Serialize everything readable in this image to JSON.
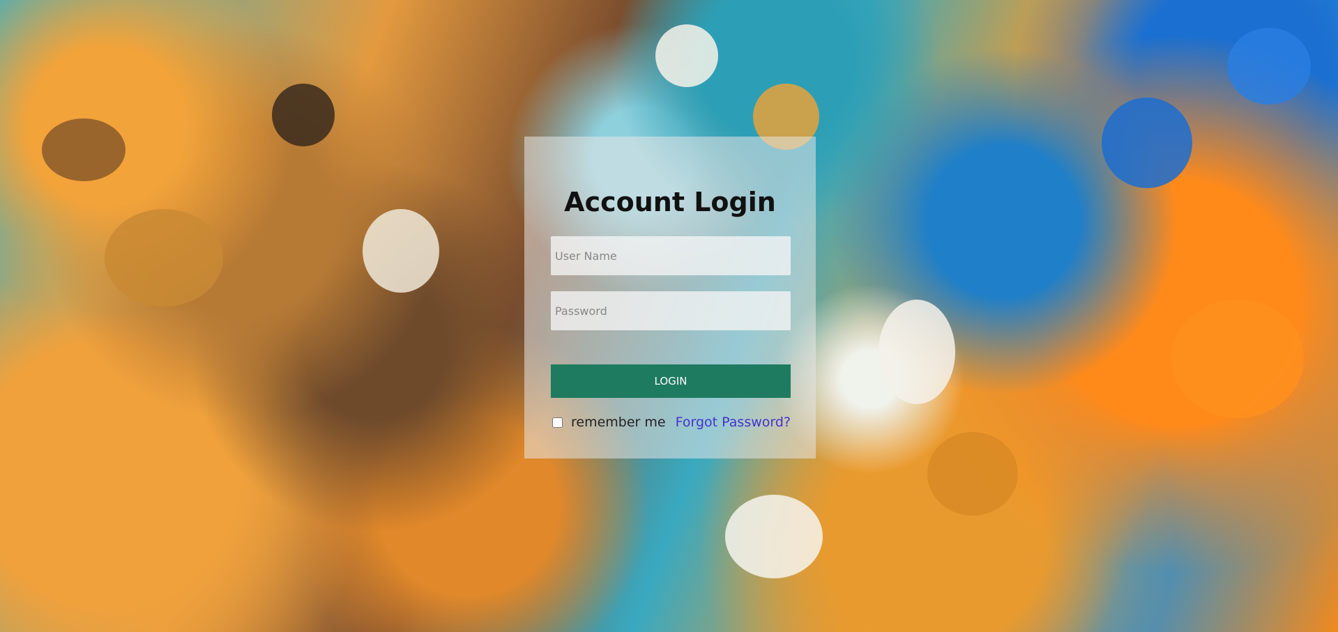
{
  "login_card": {
    "title": "Account Login",
    "username_placeholder": "User Name",
    "password_placeholder": "Password",
    "login_label": "LOGIN",
    "remember_label": "remember me",
    "remember_checked": false,
    "forgot_label": "Forgot Password?"
  },
  "colors": {
    "login_button": "#1e7b5f",
    "forgot_link": "#4433cc"
  }
}
